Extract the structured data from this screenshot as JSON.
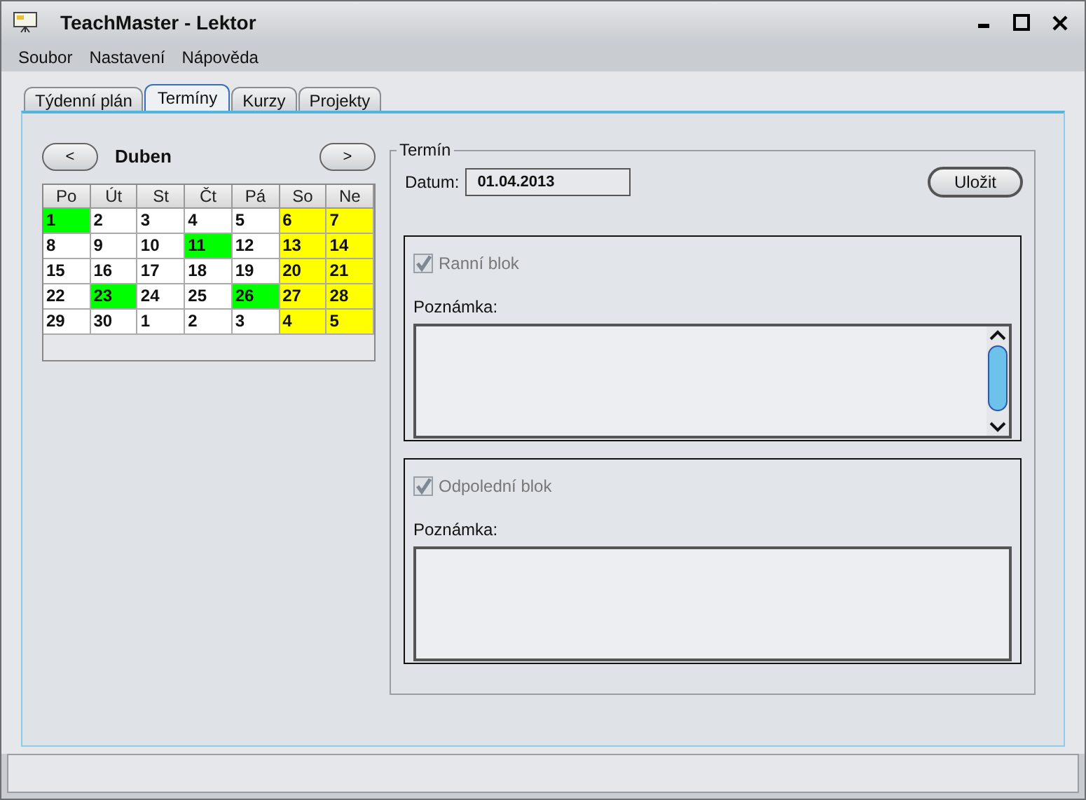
{
  "window": {
    "title": "TeachMaster - Lektor"
  },
  "menu": [
    "Soubor",
    "Nastavení",
    "Nápověda"
  ],
  "tabs": [
    {
      "label": "Týdenní plán",
      "selected": false
    },
    {
      "label": "Termíny",
      "selected": true
    },
    {
      "label": "Kurzy",
      "selected": false
    },
    {
      "label": "Projekty",
      "selected": false
    }
  ],
  "calendar": {
    "prev": "<",
    "month": "Duben",
    "next": ">",
    "weekdays": [
      "Po",
      "Út",
      "St",
      "Čt",
      "Pá",
      "So",
      "Ne"
    ],
    "days": [
      {
        "text": "1",
        "color": "#00ff00"
      },
      {
        "text": "2",
        "color": "#ffffff"
      },
      {
        "text": "3",
        "color": "#ffffff"
      },
      {
        "text": "4",
        "color": "#ffffff"
      },
      {
        "text": "5",
        "color": "#ffffff"
      },
      {
        "text": "6",
        "color": "#ffff00"
      },
      {
        "text": "7",
        "color": "#ffff00"
      },
      {
        "text": "8",
        "color": "#ffffff"
      },
      {
        "text": "9",
        "color": "#ffffff"
      },
      {
        "text": "10",
        "color": "#ffffff"
      },
      {
        "text": "11",
        "color": "#00ff00"
      },
      {
        "text": "12",
        "color": "#ffffff"
      },
      {
        "text": "13",
        "color": "#ffff00"
      },
      {
        "text": "14",
        "color": "#ffff00"
      },
      {
        "text": "15",
        "color": "#ffffff"
      },
      {
        "text": "16",
        "color": "#ffffff"
      },
      {
        "text": "17",
        "color": "#ffffff"
      },
      {
        "text": "18",
        "color": "#ffffff"
      },
      {
        "text": "19",
        "color": "#ffffff"
      },
      {
        "text": "20",
        "color": "#ffff00"
      },
      {
        "text": "21",
        "color": "#ffff00"
      },
      {
        "text": "22",
        "color": "#ffffff"
      },
      {
        "text": "23",
        "color": "#00ff00"
      },
      {
        "text": "24",
        "color": "#ffffff"
      },
      {
        "text": "25",
        "color": "#ffffff"
      },
      {
        "text": "26",
        "color": "#00ff00"
      },
      {
        "text": "27",
        "color": "#ffff00"
      },
      {
        "text": "28",
        "color": "#ffff00"
      },
      {
        "text": "29",
        "color": "#ffffff"
      },
      {
        "text": "30",
        "color": "#ffffff"
      },
      {
        "text": "1",
        "color": "#ffffff"
      },
      {
        "text": "2",
        "color": "#ffffff"
      },
      {
        "text": "3",
        "color": "#ffffff"
      },
      {
        "text": "4",
        "color": "#ffff00"
      },
      {
        "text": "5",
        "color": "#ffff00"
      }
    ]
  },
  "termin": {
    "title": "Termín",
    "date_label": "Datum:",
    "date_value": "01.04.2013",
    "save_button": "Uložit",
    "blocks": [
      {
        "label": "Ranní blok",
        "checked": true,
        "note_label": "Poznámka:",
        "scrollbar": true
      },
      {
        "label": "Odpolední blok",
        "checked": true,
        "note_label": "Poznámka:",
        "scrollbar": false
      }
    ]
  }
}
